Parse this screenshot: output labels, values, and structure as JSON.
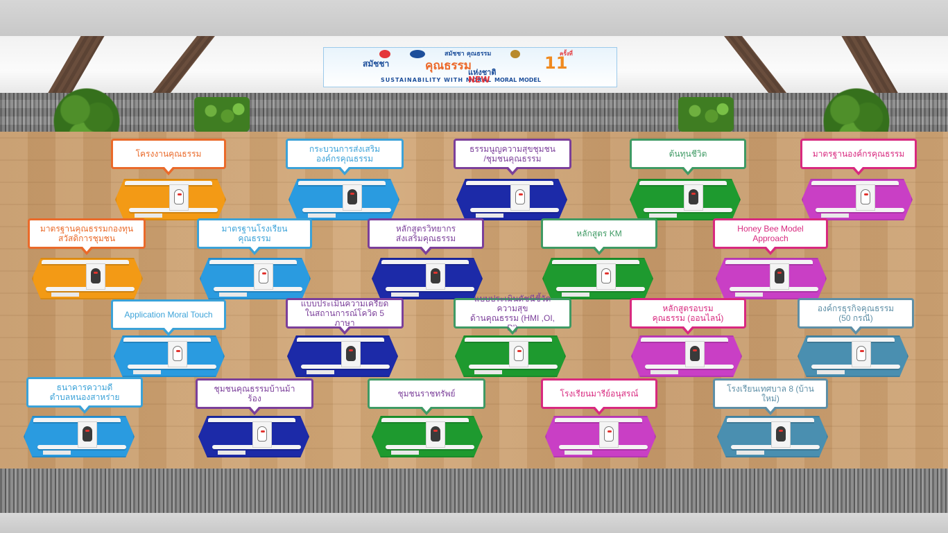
{
  "banner": {
    "logo_text": "สมัชชา คุณธรรม",
    "event_title_1": "สมัชชา",
    "event_title_2": "คุณธรรม",
    "event_title_3": "แห่งชาติ",
    "edition_number": "11",
    "edition_label": "ครั้งที่",
    "slogan_left": "SUSTAINABILITY WITH MORAL",
    "slogan_new": "NEW",
    "slogan_right": "MORAL MODEL"
  },
  "colors": {
    "orange": "#f39a15",
    "blue": "#2a9be0",
    "navy": "#1c2aa8",
    "green": "#1e9a2f",
    "magenta": "#c93fc5",
    "steel": "#4a8fb0",
    "callout_orange": "#ea6a2a",
    "callout_blue": "#3ba2d8",
    "callout_purple": "#7b3f9a",
    "callout_green": "#3f9a64",
    "callout_magenta": "#d8297f",
    "callout_steel": "#5e8fa6"
  },
  "booths": [
    {
      "label": "โครงงานคุณธรรม",
      "color": "orange",
      "mascot": "white"
    },
    {
      "label": "กระบวนการส่งเสริม\nองค์กรคุณธรรม",
      "color": "blue",
      "mascot": "black"
    },
    {
      "label": "ธรรมนูญความสุขชุมชน\n/ชุมชนคุณธรรม",
      "color": "navy",
      "mascot": "white"
    },
    {
      "label": "ต้นทุนชีวิต",
      "color": "green",
      "mascot": "black"
    },
    {
      "label": "มาตรฐานองค์กรคุณธรรม",
      "color": "magenta",
      "mascot": "white"
    },
    {
      "label": "มาตรฐานคุณธรรมกองทุน\nสวัสดิการชุมชน",
      "color": "orange",
      "mascot": "black"
    },
    {
      "label": "มาตรฐานโรงเรียนคุณธรรม",
      "color": "blue",
      "mascot": "white"
    },
    {
      "label": "หลักสูตรวิทยากร\nส่งเสริมคุณธรรม",
      "color": "navy",
      "mascot": "black"
    },
    {
      "label": "หลักสูตร KM",
      "color": "green",
      "mascot": "white"
    },
    {
      "label": "Honey Bee Model Approach",
      "color": "magenta",
      "mascot": "black"
    },
    {
      "label": "Application  Moral Touch",
      "color": "blue",
      "mascot": "white"
    },
    {
      "label": "แบบประเมินความเครียด\nในสถานการณ์โควิด 5 ภาษา",
      "color": "navy",
      "mascot": "black"
    },
    {
      "label": "แบบประเมินดัชนีชี้วัดความสุข\nด้านคุณธรรม (HMI ,OI, PI)",
      "color": "green",
      "mascot": "white"
    },
    {
      "label": "หลักสูตรอบรม\nคุณธรรม (ออนไลน์)",
      "color": "magenta",
      "mascot": "black"
    },
    {
      "label": "องค์กรธุรกิจคุณธรรม\n(50 กรณี)",
      "color": "steel",
      "mascot": "white"
    },
    {
      "label": "ธนาคารความดี\nตำบลหนองสาหร่าย",
      "color": "blue",
      "mascot": "black"
    },
    {
      "label": "ชุมชนคุณธรรมบ้านม้าร้อง",
      "color": "navy",
      "mascot": "white"
    },
    {
      "label": "ชุมชนราชทรัพย์",
      "color": "green",
      "mascot": "black"
    },
    {
      "label": "โรงเรียนมารีย์อนุสรณ์",
      "color": "magenta",
      "mascot": "white"
    },
    {
      "label": "โรงเรียนเทศบาล 8 (บ้านใหม่)",
      "color": "steel",
      "mascot": "black"
    }
  ]
}
